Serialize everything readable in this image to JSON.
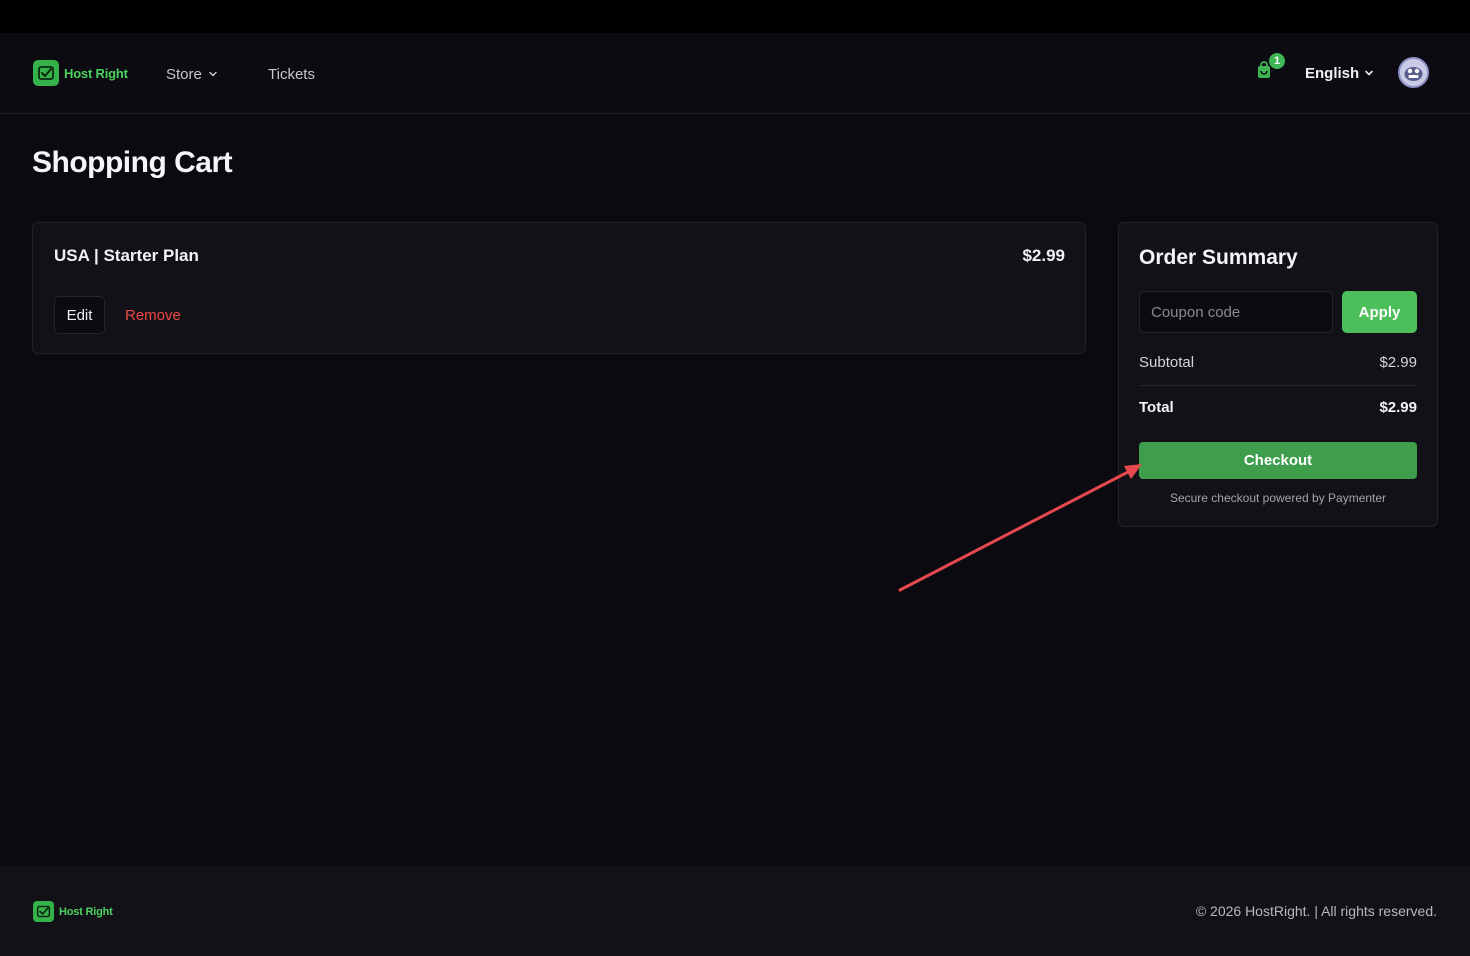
{
  "brand": {
    "name": "Host Right",
    "accent": "#4cd25f"
  },
  "nav": {
    "store_label": "Store",
    "tickets_label": "Tickets",
    "cart_count": "1",
    "language": "English"
  },
  "page": {
    "title": "Shopping Cart"
  },
  "cart": {
    "items": [
      {
        "name": "USA | Starter Plan",
        "price": "$2.99",
        "edit_label": "Edit",
        "remove_label": "Remove"
      }
    ]
  },
  "summary": {
    "title": "Order Summary",
    "coupon_placeholder": "Coupon code",
    "coupon_value": "",
    "apply_label": "Apply",
    "subtotal_label": "Subtotal",
    "subtotal_value": "$2.99",
    "total_label": "Total",
    "total_value": "$2.99",
    "checkout_label": "Checkout",
    "secure_note": "Secure checkout powered by Paymenter"
  },
  "footer": {
    "brand": "Host Right",
    "copyright": "© 2026 HostRight. | All rights reserved."
  },
  "colors": {
    "background": "#0a0a10",
    "card": "#111117",
    "primary_green": "#4cbf5a",
    "checkout_green": "#3e9e4b",
    "danger_red": "#ef4a45",
    "annotation_red": "#e5484d"
  }
}
